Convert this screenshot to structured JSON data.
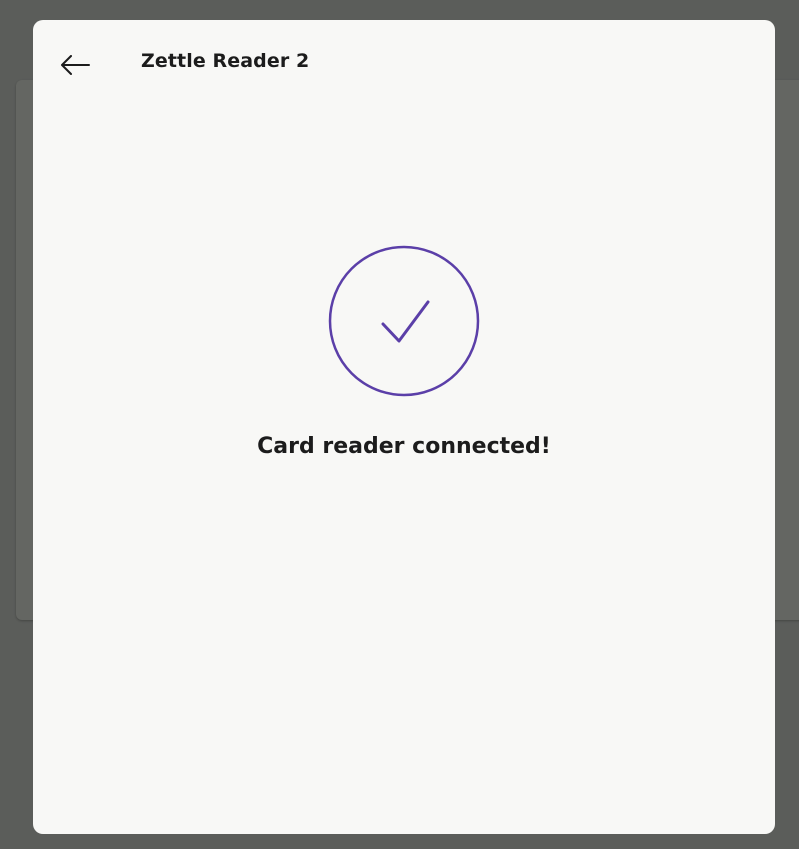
{
  "header": {
    "title": "Zettle Reader 2",
    "back_icon": "arrow-left-icon"
  },
  "status": {
    "icon": "checkmark-icon",
    "message": "Card reader connected!",
    "accent_color": "#5b3fa8"
  }
}
